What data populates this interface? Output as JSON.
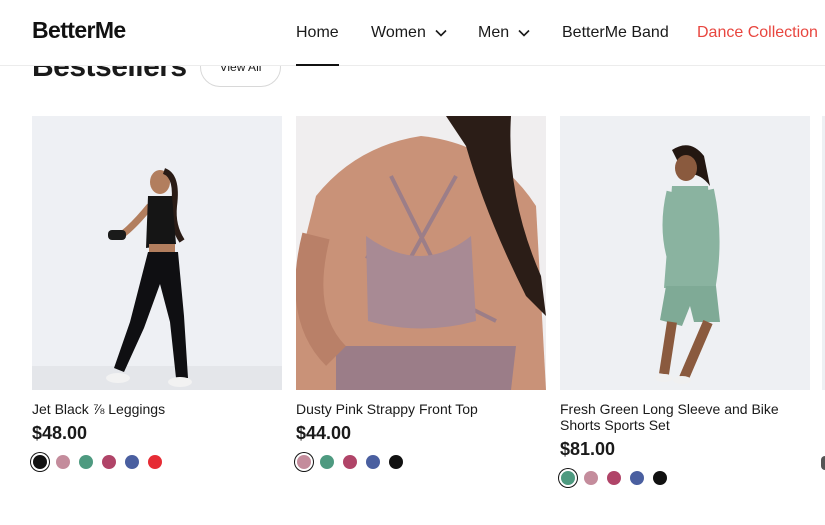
{
  "header": {
    "logo": "BetterMe",
    "nav": [
      {
        "label": "Home",
        "active": true,
        "dropdown": false
      },
      {
        "label": "Women",
        "active": false,
        "dropdown": true
      },
      {
        "label": "Men",
        "active": false,
        "dropdown": true
      },
      {
        "label": "BetterMe Band",
        "active": false,
        "dropdown": false
      },
      {
        "label": "Dance Collection",
        "active": false,
        "dropdown": false,
        "accent": "#e8463f"
      }
    ]
  },
  "section": {
    "title": "Bestsellers",
    "view_all": "View All"
  },
  "products": [
    {
      "name": "Jet Black ⅞ Leggings",
      "price": "$48.00",
      "image": "woman-black-leggings-photo",
      "colors": [
        "#111111",
        "#c48c9c",
        "#4e9a80",
        "#b04468",
        "#4a5fa0",
        "#e62c35"
      ],
      "selected_color": 0
    },
    {
      "name": "Dusty Pink Strappy Front Top",
      "price": "$44.00",
      "image": "dusty-pink-strappy-top-photo",
      "colors": [
        "#c48c9c",
        "#4e9a80",
        "#b04468",
        "#4a5fa0",
        "#111111"
      ],
      "selected_color": 0
    },
    {
      "name": "Fresh Green Long Sleeve and Bike Shorts Sports Set",
      "price": "$81.00",
      "image": "green-long-sleeve-set-photo",
      "colors": [
        "#4e9a80",
        "#c48c9c",
        "#b04468",
        "#4a5fa0",
        "#111111"
      ],
      "selected_color": 0
    }
  ]
}
